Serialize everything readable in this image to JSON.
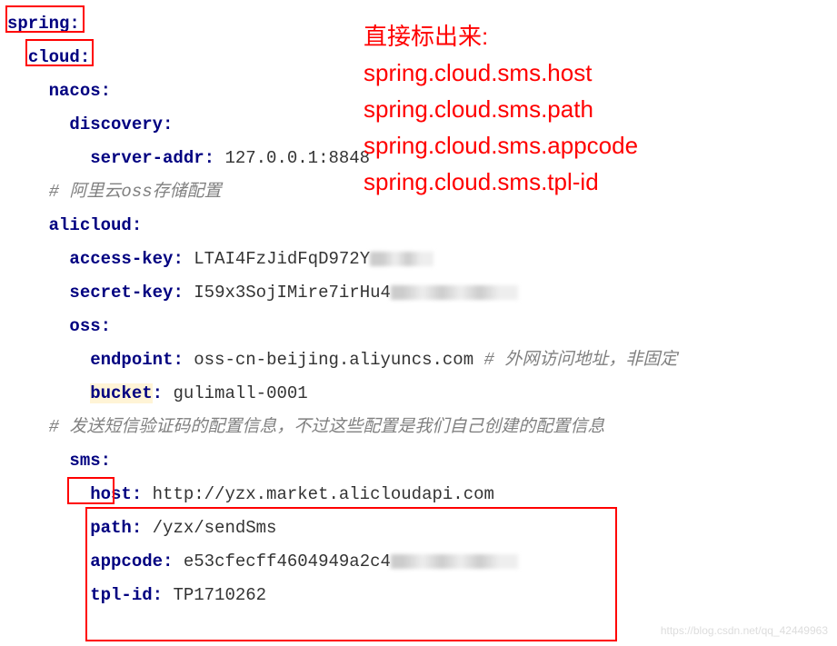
{
  "yaml": {
    "spring": "spring",
    "cloud": "cloud",
    "nacos": "nacos",
    "discovery": "discovery",
    "server_addr_key": "server-addr",
    "server_addr_val": "127.0.0.1:8848",
    "comment_oss": "# 阿里云oss存储配置",
    "alicloud": "alicloud",
    "access_key": "access-key",
    "access_key_val": "LTAI4FzJidFqD972Y",
    "secret_key": "secret-key",
    "secret_key_val": "I59x3SojIMire7irHu4",
    "oss": "oss",
    "endpoint_key": "endpoint",
    "endpoint_val": "oss-cn-beijing.aliyuncs.com",
    "endpoint_comment": "# 外网访问地址，非固定",
    "bucket_key": "bucket",
    "bucket_val": "gulimall-0001",
    "comment_sms": "# 发送短信验证码的配置信息，不过这些配置是我们自己创建的配置信息",
    "sms": "sms",
    "host_key": "host",
    "host_val": "http://yzx.market.alicloudapi.com",
    "path_key": "path",
    "path_val": "/yzx/sendSms",
    "appcode_key": "appcode",
    "appcode_val": "e53cfecff4604949a2c4",
    "tpl_id_key": "tpl-id",
    "tpl_id_val": "TP1710262"
  },
  "annotation": {
    "line1": "直接标出来:",
    "line2": "spring.cloud.sms.host",
    "line3": "spring.cloud.sms.path",
    "line4": "spring.cloud.sms.appcode",
    "line5": "spring.cloud.sms.tpl-id"
  },
  "watermark": "https://blog.csdn.net/qq_42449963"
}
